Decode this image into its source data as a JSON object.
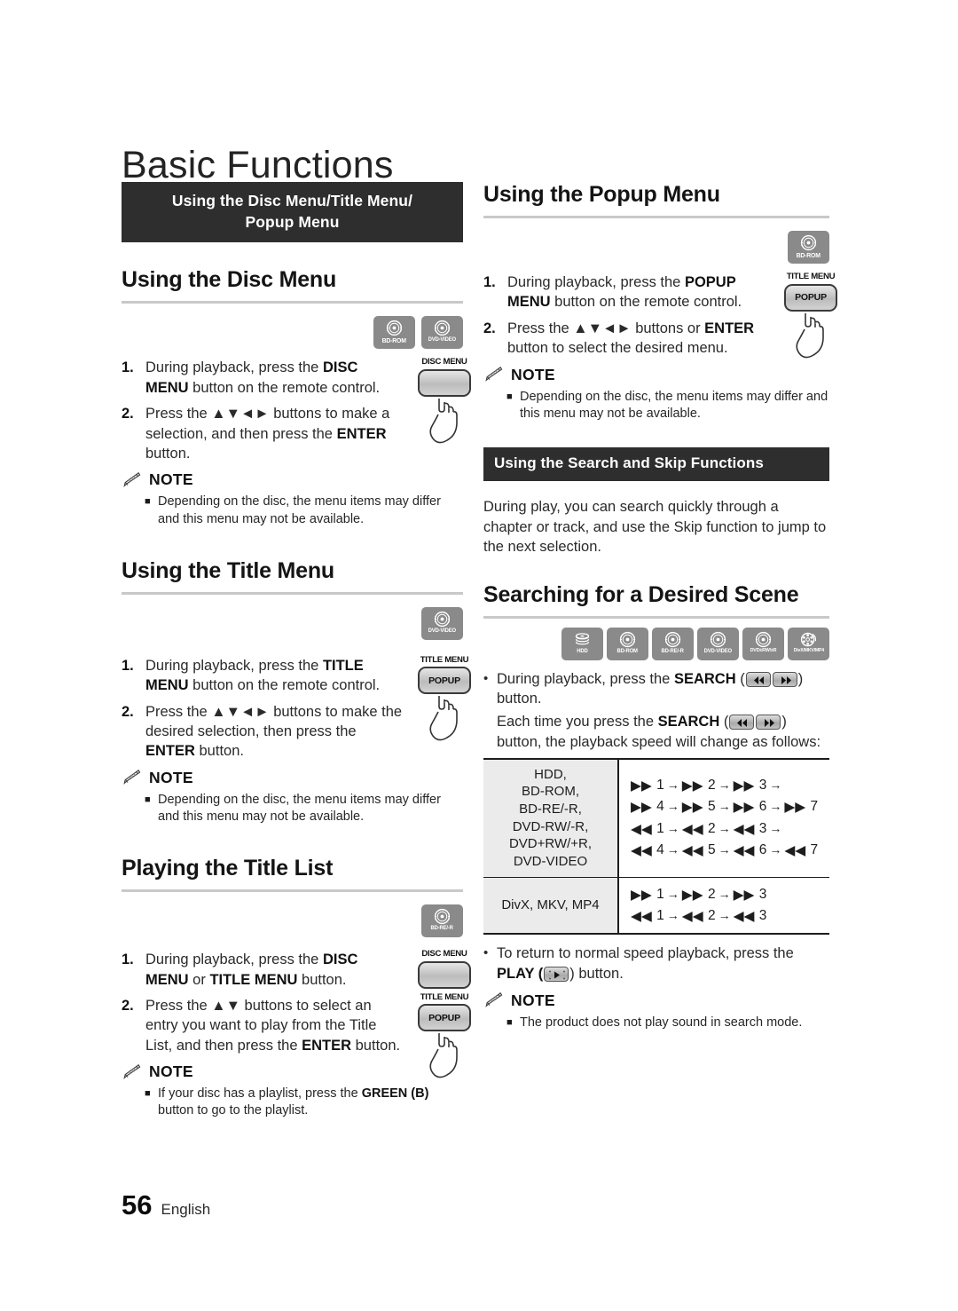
{
  "chapter": {
    "title": "Basic Functions"
  },
  "footer": {
    "page_number": "56",
    "language": "English"
  },
  "left_column": {
    "banner": "Using the Disc Menu/Title Menu/ Popup Menu",
    "banner_line1": "Using the Disc Menu/Title Menu/",
    "banner_line2": "Popup Menu",
    "sections": [
      {
        "heading": "Using the Disc Menu",
        "badges": [
          {
            "caption": "BD-ROM",
            "icon": "disc-icon"
          },
          {
            "caption": "DVD-VIDEO",
            "icon": "disc-icon"
          }
        ],
        "keys": [
          {
            "label": "DISC MENU",
            "face": ""
          }
        ],
        "steps": [
          {
            "num": "1.",
            "text": "During playback, press the DISC MENU button on the remote control."
          },
          {
            "num": "2.",
            "text": "Press the ▲▼ ◄ ► buttons to make a selection, and then press the ENTER button."
          }
        ],
        "note_label": "NOTE",
        "notes": [
          "Depending on the disc, the menu items may differ and this menu may not be available."
        ]
      },
      {
        "heading": "Using the Title Menu",
        "badges": [
          {
            "caption": "DVD-VIDEO",
            "icon": "disc-icon"
          }
        ],
        "keys": [
          {
            "label": "TITLE MENU",
            "face": "POPUP"
          }
        ],
        "steps": [
          {
            "num": "1.",
            "text": "During playback, press the TITLE MENU button on the remote control."
          },
          {
            "num": "2.",
            "text": "Press the ▲▼ ◄ ► buttons to make the desired selection, then press the ENTER button."
          }
        ],
        "note_label": "NOTE",
        "notes": [
          "Depending on the disc, the menu items may differ and this menu may not be available."
        ]
      },
      {
        "heading": "Playing the Title List",
        "badges": [
          {
            "caption": "BD-RE/-R",
            "icon": "disc-icon"
          }
        ],
        "keys": [
          {
            "label": "DISC MENU",
            "face": ""
          },
          {
            "label": "TITLE MENU",
            "face": "POPUP"
          }
        ],
        "steps": [
          {
            "num": "1.",
            "text": "During playback, press the DISC MENU or TITLE MENU button."
          },
          {
            "num": "2.",
            "text": "Press the ▲▼ buttons to select an entry you want to play from the Title List, and then press the ENTER button."
          }
        ],
        "note_label": "NOTE",
        "notes": [
          "If your disc has a playlist, press the GREEN (B) button to go to the playlist."
        ]
      }
    ]
  },
  "right_column": {
    "popup_section": {
      "heading": "Using the Popup Menu",
      "badges": [
        {
          "caption": "BD-ROM",
          "icon": "disc-icon"
        }
      ],
      "keys": [
        {
          "label": "TITLE MENU",
          "face": "POPUP"
        }
      ],
      "steps": [
        {
          "num": "1.",
          "text": "During playback, press the POPUP MENU button on the remote control."
        },
        {
          "num": "2.",
          "text": "Press the ▲▼ ◄ ► buttons or ENTER button to select the desired menu."
        }
      ],
      "note_label": "NOTE",
      "notes": [
        "Depending on the disc, the menu items may differ and this menu may not be available."
      ]
    },
    "search_banner": "Using the Search and Skip Functions",
    "search_intro": "During play, you can search quickly through a chapter or track, and use the Skip function to jump to the next selection.",
    "scene_section": {
      "heading": "Searching for a Desired Scene",
      "badges": [
        {
          "caption": "HDD",
          "icon": "hdd-icon"
        },
        {
          "caption": "BD-ROM",
          "icon": "disc-icon"
        },
        {
          "caption": "BD-RE/-R",
          "icon": "disc-icon"
        },
        {
          "caption": "DVD-VIDEO",
          "icon": "disc-icon"
        },
        {
          "caption": "DVD±RW/±R",
          "icon": "disc-icon"
        },
        {
          "caption": "DivX/MKV/MP4",
          "icon": "film-icon"
        }
      ],
      "bullet1_a": "During playback, press the SEARCH (",
      "bullet1_b": ") button.",
      "bullet1_c": "Each time you press the SEARCH (",
      "bullet1_d": ")",
      "bullet1_e": "button, the playback speed will change as follows:",
      "bullet2_a": "To return to normal speed playback, press the",
      "bullet2_b": "PLAY (",
      "bullet2_c": ") button.",
      "note_label": "NOTE",
      "notes": [
        "The product does not play sound in search mode."
      ]
    },
    "speed_table": {
      "rows": [
        {
          "formats": [
            "HDD,",
            "BD-ROM,",
            "BD-RE/-R,",
            "DVD-RW/-R,",
            "DVD+RW/+R,",
            "DVD-VIDEO"
          ],
          "sequences": [
            {
              "dir": "forward",
              "steps": [
                "1",
                "2",
                "3"
              ],
              "trailing_arrow": true
            },
            {
              "dir": "forward",
              "steps": [
                "4",
                "5",
                "6",
                "7"
              ],
              "trailing_arrow": false
            },
            {
              "dir": "reverse",
              "steps": [
                "1",
                "2",
                "3"
              ],
              "trailing_arrow": true
            },
            {
              "dir": "reverse",
              "steps": [
                "4",
                "5",
                "6",
                "7"
              ],
              "trailing_arrow": false
            }
          ]
        },
        {
          "formats": [
            "DivX, MKV, MP4"
          ],
          "sequences": [
            {
              "dir": "forward",
              "steps": [
                "1",
                "2",
                "3"
              ],
              "trailing_arrow": false
            },
            {
              "dir": "reverse",
              "steps": [
                "1",
                "2",
                "3"
              ],
              "trailing_arrow": false
            }
          ]
        }
      ]
    }
  }
}
